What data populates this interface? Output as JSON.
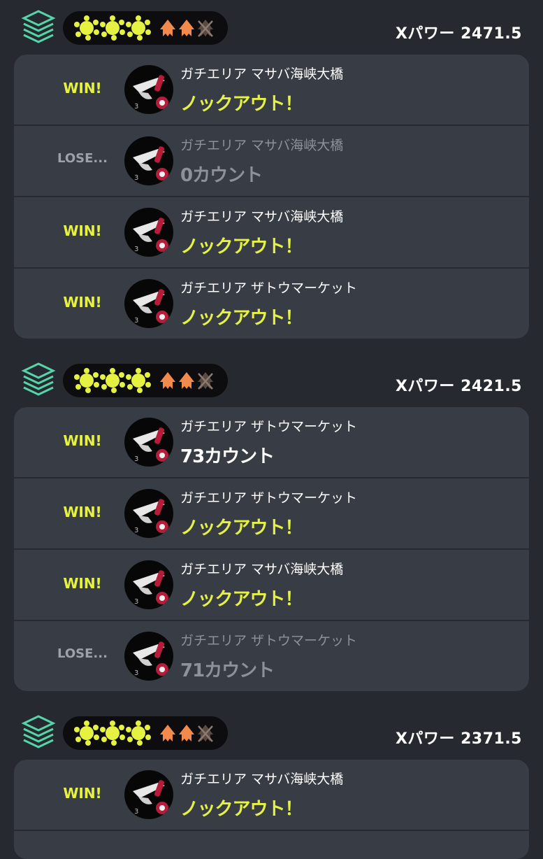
{
  "colors": {
    "background": "#262930",
    "card": "#383c44",
    "win": "#e6f241",
    "lose": "#9ea1a8",
    "rank_icon": "#54d6a8",
    "squid_orange": "#f28a4b"
  },
  "groups": [
    {
      "xpower": "Xパワー 2471.5",
      "icons": {
        "rank": "layers-icon",
        "wins": "splat-icon",
        "losses": "squid-icon"
      },
      "matches": [
        {
          "result": "WIN!",
          "is_win": true,
          "stage": "ガチエリア マサバ海峡大橋",
          "outcome": "ノックアウト！",
          "outcome_type": "knockout"
        },
        {
          "result": "LOSE...",
          "is_win": false,
          "stage": "ガチエリア マサバ海峡大橋",
          "outcome": "0カウント",
          "outcome_type": "count"
        },
        {
          "result": "WIN!",
          "is_win": true,
          "stage": "ガチエリア マサバ海峡大橋",
          "outcome": "ノックアウト！",
          "outcome_type": "knockout"
        },
        {
          "result": "WIN!",
          "is_win": true,
          "stage": "ガチエリア ザトウマーケット",
          "outcome": "ノックアウト！",
          "outcome_type": "knockout"
        }
      ]
    },
    {
      "xpower": "Xパワー 2421.5",
      "icons": {
        "rank": "layers-icon",
        "wins": "splat-icon",
        "losses": "squid-icon"
      },
      "matches": [
        {
          "result": "WIN!",
          "is_win": true,
          "stage": "ガチエリア ザトウマーケット",
          "outcome": "73カウント",
          "outcome_type": "count"
        },
        {
          "result": "WIN!",
          "is_win": true,
          "stage": "ガチエリア ザトウマーケット",
          "outcome": "ノックアウト！",
          "outcome_type": "knockout"
        },
        {
          "result": "WIN!",
          "is_win": true,
          "stage": "ガチエリア マサバ海峡大橋",
          "outcome": "ノックアウト！",
          "outcome_type": "knockout"
        },
        {
          "result": "LOSE...",
          "is_win": false,
          "stage": "ガチエリア ザトウマーケット",
          "outcome": "71カウント",
          "outcome_type": "count"
        }
      ]
    },
    {
      "xpower": "Xパワー 2371.5",
      "icons": {
        "rank": "layers-icon",
        "wins": "splat-icon",
        "losses": "squid-icon"
      },
      "matches": [
        {
          "result": "WIN!",
          "is_win": true,
          "stage": "ガチエリア マサバ海峡大橋",
          "outcome": "ノックアウト！",
          "outcome_type": "knockout"
        }
      ]
    }
  ]
}
